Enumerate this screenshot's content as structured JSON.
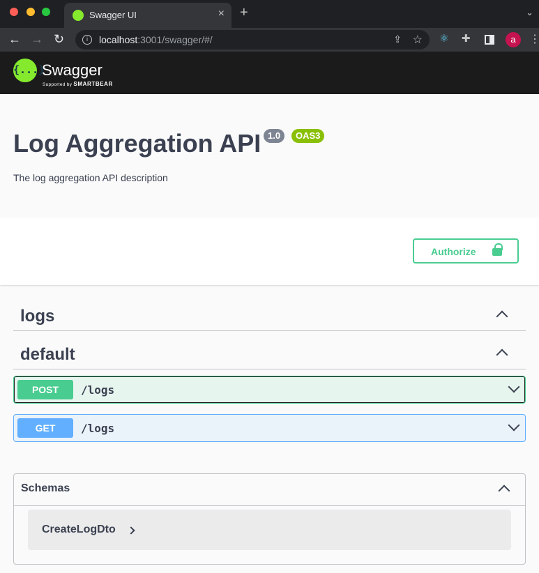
{
  "browser": {
    "tab_title": "Swagger UI",
    "url_host": "localhost",
    "url_rest": ":3001/swagger/#/",
    "avatar_letter": "a"
  },
  "swagger": {
    "logo_word": "Swagger",
    "logo_sub_prefix": "Supported by",
    "logo_sub_brand": "SMARTBEAR",
    "logo_braces": "{...}"
  },
  "info": {
    "title": "Log Aggregation API",
    "version": "1.0",
    "oas": "OAS3",
    "description": "The log aggregation API description"
  },
  "authorize_label": "Authorize",
  "tags": [
    {
      "name": "logs"
    },
    {
      "name": "default"
    }
  ],
  "operations": [
    {
      "method": "POST",
      "path": "/logs"
    },
    {
      "method": "GET",
      "path": "/logs"
    }
  ],
  "schemas": {
    "title": "Schemas",
    "items": [
      "CreateLogDto"
    ]
  },
  "colors": {
    "post": "#49cc90",
    "get": "#61affe",
    "logo": "#85ea2d"
  }
}
